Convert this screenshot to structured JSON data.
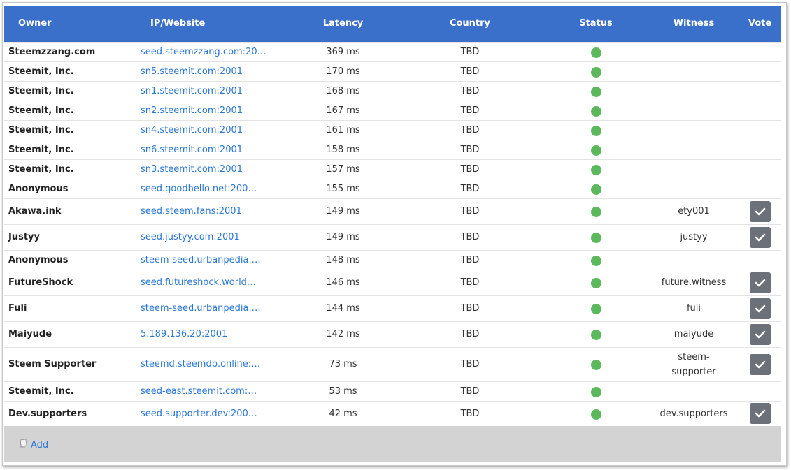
{
  "columns": {
    "owner": "Owner",
    "site": "IP/Website",
    "latency": "Latency",
    "country": "Country",
    "status": "Status",
    "witness": "Witness",
    "vote": "Vote"
  },
  "rows": [
    {
      "owner": "Steemzzang.com",
      "site": "seed.steemzzang.com:20…",
      "latency": "369 ms",
      "country": "TBD",
      "status": "online",
      "witness": "",
      "vote": false
    },
    {
      "owner": "Steemit, Inc.",
      "site": "sn5.steemit.com:2001",
      "latency": "170 ms",
      "country": "TBD",
      "status": "online",
      "witness": "",
      "vote": false
    },
    {
      "owner": "Steemit, Inc.",
      "site": "sn1.steemit.com:2001",
      "latency": "168 ms",
      "country": "TBD",
      "status": "online",
      "witness": "",
      "vote": false
    },
    {
      "owner": "Steemit, Inc.",
      "site": "sn2.steemit.com:2001",
      "latency": "167 ms",
      "country": "TBD",
      "status": "online",
      "witness": "",
      "vote": false
    },
    {
      "owner": "Steemit, Inc.",
      "site": "sn4.steemit.com:2001",
      "latency": "161 ms",
      "country": "TBD",
      "status": "online",
      "witness": "",
      "vote": false
    },
    {
      "owner": "Steemit, Inc.",
      "site": "sn6.steemit.com:2001",
      "latency": "158 ms",
      "country": "TBD",
      "status": "online",
      "witness": "",
      "vote": false
    },
    {
      "owner": "Steemit, Inc.",
      "site": "sn3.steemit.com:2001",
      "latency": "157 ms",
      "country": "TBD",
      "status": "online",
      "witness": "",
      "vote": false
    },
    {
      "owner": "Anonymous",
      "site": "seed.goodhello.net:200…",
      "latency": "155 ms",
      "country": "TBD",
      "status": "online",
      "witness": "",
      "vote": false
    },
    {
      "owner": "Akawa.ink",
      "site": "seed.steem.fans:2001",
      "latency": "149 ms",
      "country": "TBD",
      "status": "online",
      "witness": "ety001",
      "vote": true
    },
    {
      "owner": "Justyy",
      "site": "seed.justyy.com:2001",
      "latency": "149 ms",
      "country": "TBD",
      "status": "online",
      "witness": "justyy",
      "vote": true
    },
    {
      "owner": "Anonymous",
      "site": "steem-seed.urbanpedia.…",
      "latency": "148 ms",
      "country": "TBD",
      "status": "online",
      "witness": "",
      "vote": false
    },
    {
      "owner": "FutureShock",
      "site": "seed.futureshock.world…",
      "latency": "146 ms",
      "country": "TBD",
      "status": "online",
      "witness": "future.witness",
      "vote": true
    },
    {
      "owner": "Fuli",
      "site": "steem-seed.urbanpedia.…",
      "latency": "144 ms",
      "country": "TBD",
      "status": "online",
      "witness": "fuli",
      "vote": true
    },
    {
      "owner": "Maiyude",
      "site": "5.189.136.20:2001",
      "latency": "142 ms",
      "country": "TBD",
      "status": "online",
      "witness": "maiyude",
      "vote": true
    },
    {
      "owner": "Steem Supporter",
      "site": "steemd.steemdb.online:…",
      "latency": "73 ms",
      "country": "TBD",
      "status": "online",
      "witness": "steem-supporter",
      "witness_l1": "steem-",
      "witness_l2": "supporter",
      "vote": true
    },
    {
      "owner": "Steemit, Inc.",
      "site": "seed-east.steemit.com:…",
      "latency": "53 ms",
      "country": "TBD",
      "status": "online",
      "witness": "",
      "vote": false
    },
    {
      "owner": "Dev.supporters",
      "site": "seed.supporter.dev:200…",
      "latency": "42 ms",
      "country": "TBD",
      "status": "online",
      "witness": "dev.supporters",
      "vote": true
    }
  ],
  "footer": {
    "add_label": "Add",
    "add_icon": "book-icon"
  },
  "colors": {
    "header_bg": "#3a6fca",
    "status_online": "#5cb85c",
    "link": "#2a77d4",
    "vote_button": "#6b7079",
    "footer_bg": "#d3d3d3"
  }
}
